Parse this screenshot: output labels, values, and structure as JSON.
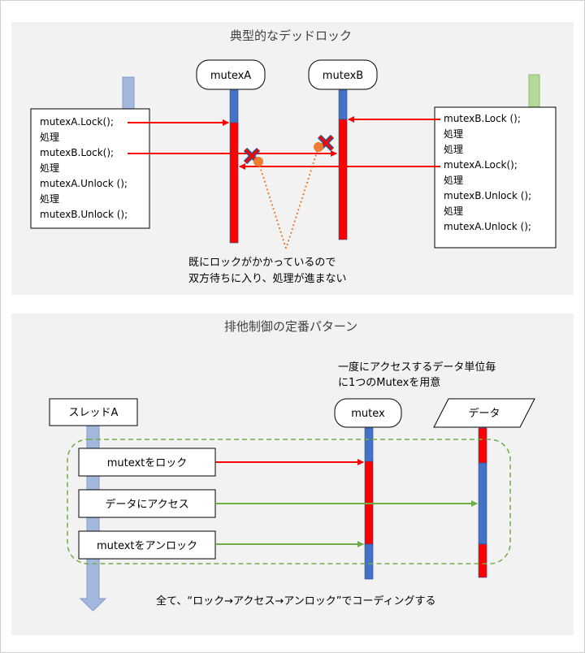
{
  "deadlock": {
    "title": "典型的なデッドロック",
    "mutexA_label": "mutexA",
    "mutexB_label": "mutexB",
    "thread1_lines": [
      "mutexA.Lock();",
      "処理",
      "mutexB.Lock();",
      "処理",
      "mutexA.Unlock ();",
      "処理",
      "mutexB.Unlock ();"
    ],
    "thread2_lines": [
      "mutexB.Lock ();",
      "処理",
      "処理",
      "mutexA.Lock();",
      "処理",
      "mutexB.Unlock ();",
      "処理",
      "mutexA.Unlock ();"
    ],
    "note_line1": "既にロックがかかっているので",
    "note_line2": "双方待ちに入り、処理が進まない"
  },
  "pattern": {
    "title": "排他制御の定番パターン",
    "thread_label": "スレッドA",
    "mutex_label": "mutex",
    "data_label": "データ",
    "note_line1": "一度にアクセスするデータ単位毎",
    "note_line2": "に1つのMutexを用意",
    "step_lock": "mutextをロック",
    "step_access": "データにアクセス",
    "step_unlock": "mutextをアンロック",
    "footer": "全て、“ロック→アクセス→アンロック”でコーディングする"
  },
  "colors": {
    "red": "#ff0000",
    "blue": "#4472c4",
    "green": "#70ad47",
    "orange": "#ed7d31",
    "panel": "#f2f2f2"
  }
}
